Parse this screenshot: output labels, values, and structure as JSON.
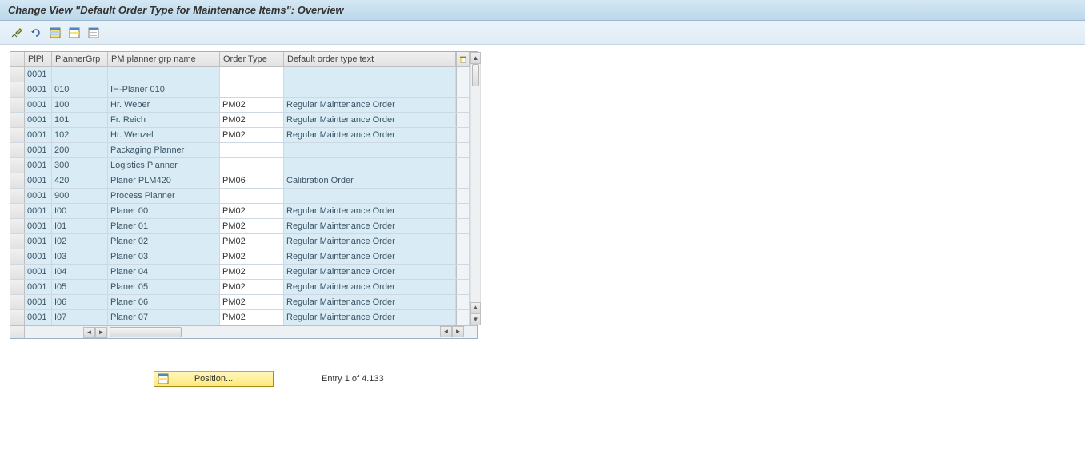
{
  "title": "Change View \"Default Order Type for Maintenance Items\": Overview",
  "toolbar": {
    "icons": [
      "toggle-display-change",
      "undo",
      "select-all",
      "select-block",
      "deselect-all"
    ]
  },
  "columns": {
    "plpl": "PlPl",
    "plannerGrp": "PlannerGrp",
    "plannerName": "PM planner grp name",
    "orderType": "Order Type",
    "orderTypeText": "Default order type text"
  },
  "rows": [
    {
      "plpl": "0001",
      "grp": "",
      "name": "",
      "otype": "",
      "otext": ""
    },
    {
      "plpl": "0001",
      "grp": "010",
      "name": "IH-Planer 010",
      "otype": "",
      "otext": ""
    },
    {
      "plpl": "0001",
      "grp": "100",
      "name": "Hr. Weber",
      "otype": "PM02",
      "otext": "Regular Maintenance Order"
    },
    {
      "plpl": "0001",
      "grp": "101",
      "name": "Fr. Reich",
      "otype": "PM02",
      "otext": "Regular Maintenance Order"
    },
    {
      "plpl": "0001",
      "grp": "102",
      "name": "Hr. Wenzel",
      "otype": "PM02",
      "otext": "Regular Maintenance Order"
    },
    {
      "plpl": "0001",
      "grp": "200",
      "name": "Packaging Planner",
      "otype": "",
      "otext": ""
    },
    {
      "plpl": "0001",
      "grp": "300",
      "name": "Logistics Planner",
      "otype": "",
      "otext": ""
    },
    {
      "plpl": "0001",
      "grp": "420",
      "name": "Planer PLM420",
      "otype": "PM06",
      "otext": "Calibration Order"
    },
    {
      "plpl": "0001",
      "grp": "900",
      "name": "Process Planner",
      "otype": "",
      "otext": ""
    },
    {
      "plpl": "0001",
      "grp": "I00",
      "name": "Planer 00",
      "otype": "PM02",
      "otext": "Regular Maintenance Order"
    },
    {
      "plpl": "0001",
      "grp": "I01",
      "name": "Planer 01",
      "otype": "PM02",
      "otext": "Regular Maintenance Order"
    },
    {
      "plpl": "0001",
      "grp": "I02",
      "name": "Planer 02",
      "otype": "PM02",
      "otext": "Regular Maintenance Order"
    },
    {
      "plpl": "0001",
      "grp": "I03",
      "name": "Planer 03",
      "otype": "PM02",
      "otext": "Regular Maintenance Order"
    },
    {
      "plpl": "0001",
      "grp": "I04",
      "name": "Planer 04",
      "otype": "PM02",
      "otext": "Regular Maintenance Order"
    },
    {
      "plpl": "0001",
      "grp": "I05",
      "name": "Planer 05",
      "otype": "PM02",
      "otext": "Regular Maintenance Order"
    },
    {
      "plpl": "0001",
      "grp": "I06",
      "name": "Planer 06",
      "otype": "PM02",
      "otext": "Regular Maintenance Order"
    },
    {
      "plpl": "0001",
      "grp": "I07",
      "name": "Planer 07",
      "otype": "PM02",
      "otext": "Regular Maintenance Order"
    }
  ],
  "footer": {
    "positionButton": "Position...",
    "entryText": "Entry 1 of 4.133"
  }
}
